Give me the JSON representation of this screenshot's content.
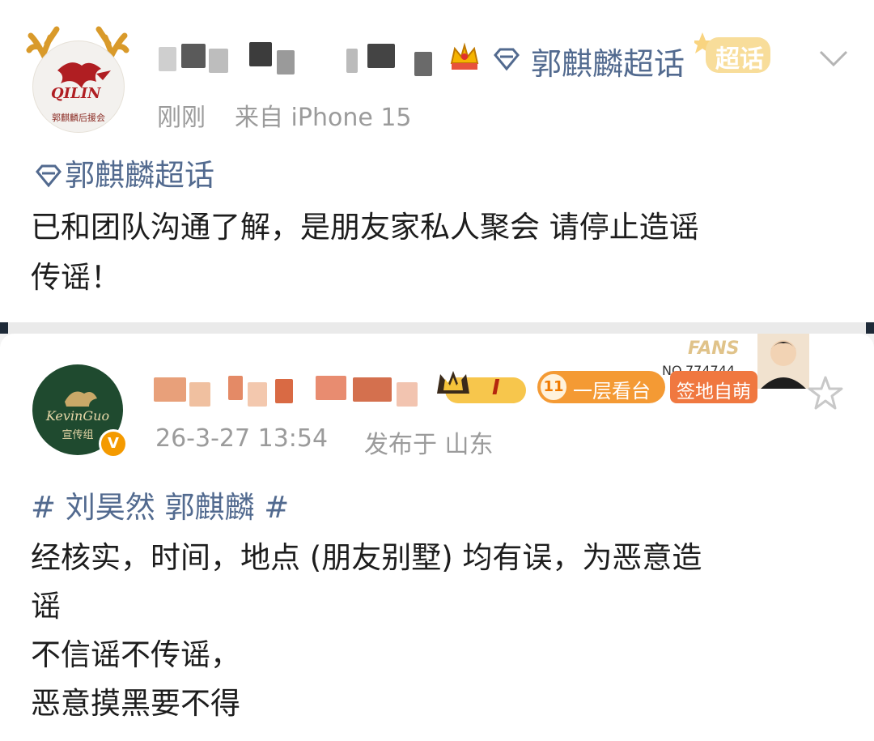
{
  "post1": {
    "avatar_logo_text": "QILIN",
    "avatar_caption": "郭麒麟后援会",
    "supertopic_name": "郭麒麟超话",
    "supertopic_tag": "超话",
    "time": "刚刚",
    "source": "来自 iPhone 15",
    "topic_link": "郭麒麟超话",
    "body_lines": [
      "已和团队沟通了解，是朋友家私人聚会 请停止造谣",
      "传谣！"
    ],
    "icons": [
      "antler-icon",
      "crown-badge-icon",
      "diamond-icon",
      "chevron-down-icon"
    ]
  },
  "post2": {
    "avatar_logo_text": "KevinGuo",
    "avatar_caption": "宣传组",
    "verified_mark": "V",
    "level_badge": "I",
    "fan_level": "11",
    "fan_rank": "一层看台",
    "sign_badge": "签地自萌",
    "fans_label": "FANS",
    "fans_number": "NO.774744",
    "timestamp": "26-3-27 13:54",
    "location": "发布于 山东",
    "hashtag": "# 刘昊然 郭麒麟 #",
    "body_lines": [
      "经核实，时间，地点 (朋友别墅) 均有误，为恶意造",
      "谣",
      "不信谣不传谣，",
      "恶意摸黑要不得"
    ],
    "icons": [
      "crown-badge-icon",
      "star-icon",
      "verified-icon",
      "fan-portrait-icon"
    ]
  },
  "colors": {
    "link": "#526a8f",
    "meta": "#9b9b9b",
    "orange_badge": "#f49a34",
    "gold": "#f2b84a"
  }
}
